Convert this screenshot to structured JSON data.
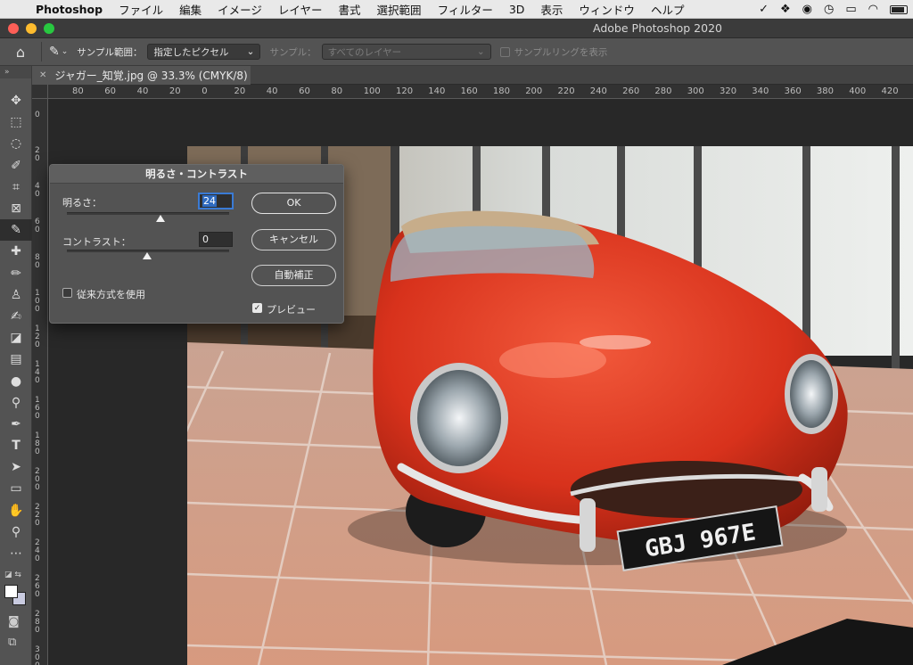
{
  "menubar": {
    "app": "Photoshop",
    "items": [
      "ファイル",
      "編集",
      "イメージ",
      "レイヤー",
      "書式",
      "選択範囲",
      "フィルター",
      "3D",
      "表示",
      "ウィンドウ",
      "ヘルプ"
    ]
  },
  "window": {
    "title": "Adobe Photoshop 2020"
  },
  "options": {
    "sample_size_label": "サンプル範囲：",
    "sample_size_value": "指定したピクセル",
    "sample_label": "サンプル：",
    "sample_value": "すべてのレイヤー",
    "show_ring_label": "サンプルリングを表示"
  },
  "document": {
    "tab_title": "ジャガー_知覚.jpg @ 33.3% (CMYK/8)"
  },
  "ruler": {
    "top": [
      "80",
      "60",
      "40",
      "20",
      "0",
      "20",
      "40",
      "60",
      "80",
      "100",
      "120",
      "140",
      "160",
      "180",
      "200",
      "220",
      "240",
      "260",
      "280",
      "300",
      "320",
      "340",
      "360",
      "380",
      "400",
      "420"
    ],
    "left": [
      "0",
      "2\n0",
      "4\n0",
      "6\n0",
      "8\n0",
      "1\n0\n0",
      "1\n2\n0",
      "1\n4\n0",
      "1\n6\n0",
      "1\n8\n0",
      "2\n0\n0",
      "2\n2\n0",
      "2\n4\n0",
      "2\n6\n0",
      "2\n8\n0",
      "3\n0\n0"
    ]
  },
  "dialog": {
    "title": "明るさ・コントラスト",
    "brightness_label": "明るさ：",
    "brightness_value": "24",
    "contrast_label": "コントラスト：",
    "contrast_value": "0",
    "ok": "OK",
    "cancel": "キャンセル",
    "auto": "自動補正",
    "legacy_label": "従来方式を使用",
    "preview_label": "プレビュー",
    "legacy_checked": false,
    "preview_checked": true
  },
  "photo": {
    "plate": "GBJ 967E"
  }
}
